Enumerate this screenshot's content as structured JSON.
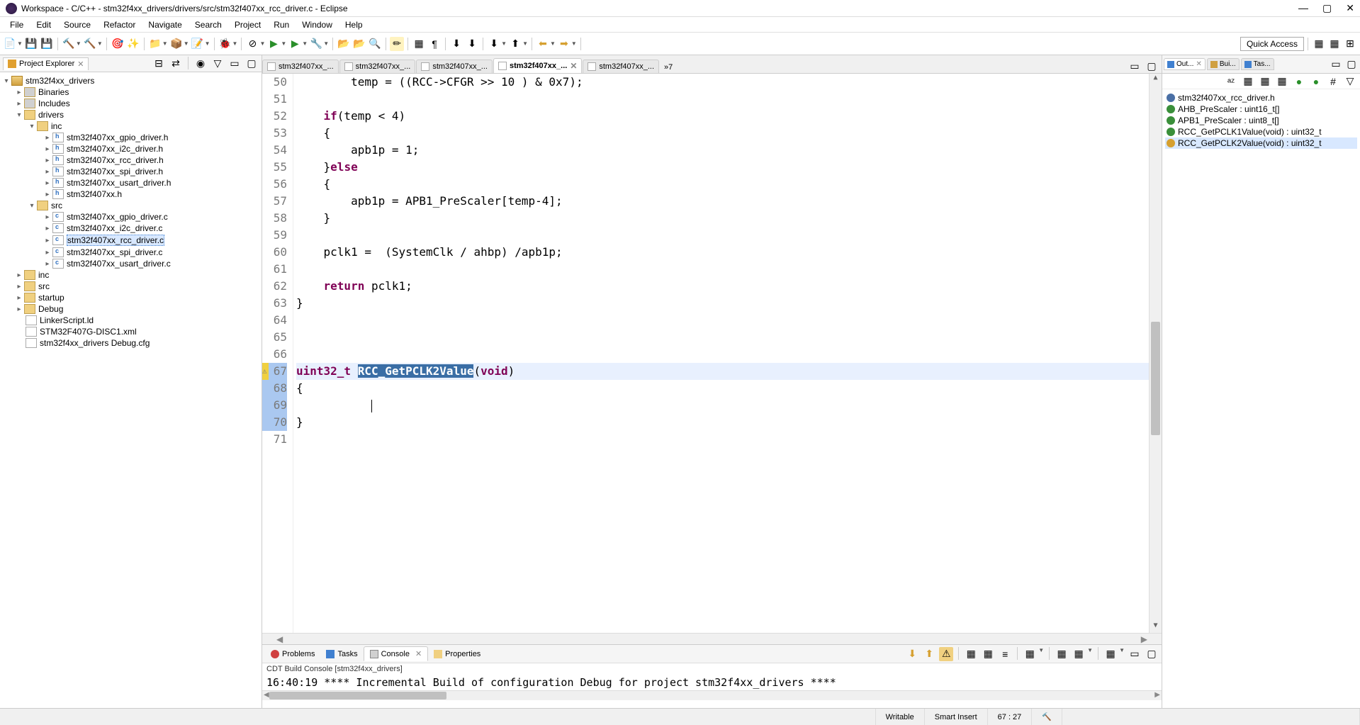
{
  "window": {
    "title": "Workspace - C/C++ - stm32f4xx_drivers/drivers/src/stm32f407xx_rcc_driver.c - Eclipse"
  },
  "menubar": [
    "File",
    "Edit",
    "Source",
    "Refactor",
    "Navigate",
    "Search",
    "Project",
    "Run",
    "Window",
    "Help"
  ],
  "quick_access": "Quick Access",
  "project_explorer": {
    "title": "Project Explorer",
    "tree": {
      "root": "stm32f4xx_drivers",
      "binaries": "Binaries",
      "includes": "Includes",
      "drivers": "drivers",
      "inc": "inc",
      "inc_files": [
        "stm32f407xx_gpio_driver.h",
        "stm32f407xx_i2c_driver.h",
        "stm32f407xx_rcc_driver.h",
        "stm32f407xx_spi_driver.h",
        "stm32f407xx_usart_driver.h",
        "stm32f407xx.h"
      ],
      "src": "src",
      "src_files": [
        "stm32f407xx_gpio_driver.c",
        "stm32f407xx_i2c_driver.c",
        "stm32f407xx_rcc_driver.c",
        "stm32f407xx_spi_driver.c",
        "stm32f407xx_usart_driver.c"
      ],
      "inc_root": "inc",
      "src_root": "src",
      "startup": "startup",
      "debug": "Debug",
      "linker": "LinkerScript.ld",
      "xml": "STM32F407G-DISC1.xml",
      "cfg": "stm32f4xx_drivers Debug.cfg"
    }
  },
  "editor_tabs": [
    "stm32f407xx_...",
    "stm32f407xx_...",
    "stm32f407xx_...",
    "stm32f407xx_...",
    "stm32f407xx_..."
  ],
  "tabs_more": "»7",
  "code": {
    "lines": [
      {
        "n": 50,
        "t": "        temp = ((RCC->CFGR >> 10 ) & 0x7);"
      },
      {
        "n": 51,
        "t": ""
      },
      {
        "n": 52,
        "t": "    if(temp < 4)",
        "kw": [
          "if"
        ]
      },
      {
        "n": 53,
        "t": "    {"
      },
      {
        "n": 54,
        "t": "        apb1p = 1;"
      },
      {
        "n": 55,
        "t": "    }else",
        "kw": [
          "else"
        ]
      },
      {
        "n": 56,
        "t": "    {"
      },
      {
        "n": 57,
        "t": "        apb1p = APB1_PreScaler[temp-4];"
      },
      {
        "n": 58,
        "t": "    }"
      },
      {
        "n": 59,
        "t": ""
      },
      {
        "n": 60,
        "t": "    pclk1 =  (SystemClk / ahbp) /apb1p;"
      },
      {
        "n": 61,
        "t": ""
      },
      {
        "n": 62,
        "t": "    return pclk1;",
        "kw": [
          "return"
        ]
      },
      {
        "n": 63,
        "t": "}"
      },
      {
        "n": 64,
        "t": ""
      },
      {
        "n": 65,
        "t": ""
      },
      {
        "n": 66,
        "t": ""
      },
      {
        "n": 67,
        "t": "uint32_t RCC_GetPCLK2Value(void)",
        "hl": true,
        "sel": "RCC_GetPCLK2Value"
      },
      {
        "n": 68,
        "t": "{"
      },
      {
        "n": 69,
        "t": "",
        "caret": true
      },
      {
        "n": 70,
        "t": "}"
      },
      {
        "n": 71,
        "t": ""
      }
    ]
  },
  "bottom": {
    "tabs": [
      "Problems",
      "Tasks",
      "Console",
      "Properties"
    ],
    "console_header": "CDT Build Console [stm32f4xx_drivers]",
    "console_line": "16:40:19 **** Incremental Build of configuration Debug for project stm32f4xx_drivers ****"
  },
  "outline": {
    "tabs": [
      "Out...",
      "Bui...",
      "Tas..."
    ],
    "items": [
      {
        "icon": "inc",
        "label": "stm32f407xx_rcc_driver.h"
      },
      {
        "icon": "var",
        "label": "AHB_PreScaler : uint16_t[]"
      },
      {
        "icon": "var",
        "label": "APB1_PreScaler : uint8_t[]"
      },
      {
        "icon": "fn",
        "label": "RCC_GetPCLK1Value(void) : uint32_t"
      },
      {
        "icon": "fn",
        "label": "RCC_GetPCLK2Value(void) : uint32_t",
        "selected": true
      }
    ]
  },
  "status": {
    "writable": "Writable",
    "insert": "Smart Insert",
    "pos": "67 : 27"
  }
}
